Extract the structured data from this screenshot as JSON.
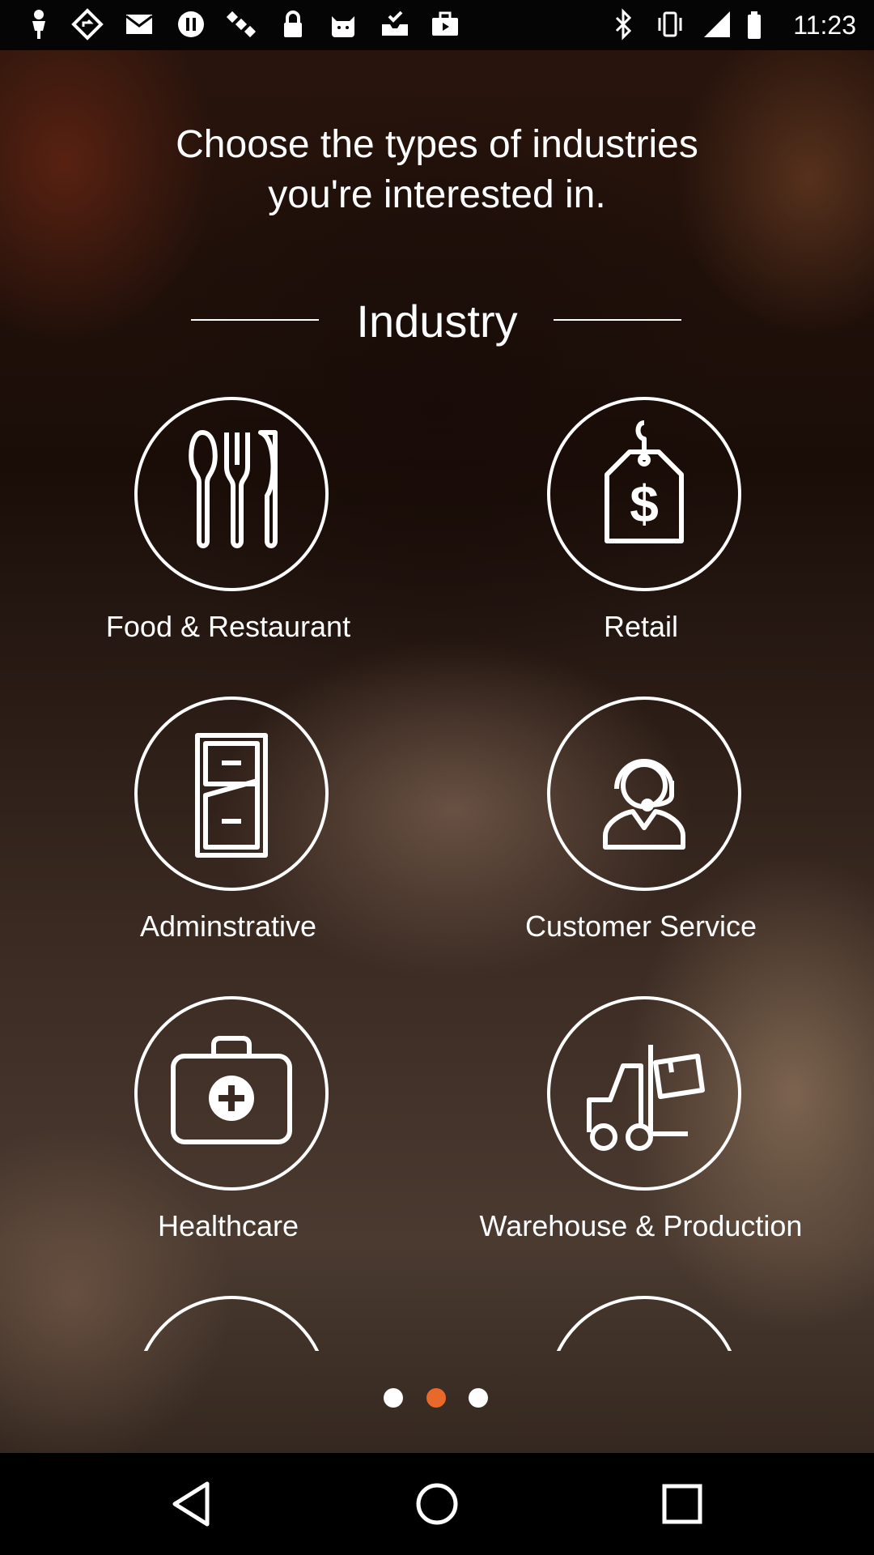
{
  "status_bar": {
    "time": "11:23",
    "icons": [
      "person-icon",
      "navigation-icon",
      "mail-icon",
      "pause-circle-icon",
      "satellite-icon",
      "lock-icon",
      "cat-icon",
      "tray-check-icon",
      "briefcase-icon",
      "bluetooth-icon",
      "vibrate-icon",
      "signal-icon",
      "battery-icon"
    ]
  },
  "heading": {
    "line1": "Choose the types of industries",
    "line2": "you're interested in."
  },
  "section": {
    "title": "Industry"
  },
  "industries": [
    {
      "label": "Food & Restaurant",
      "icon": "utensils-icon"
    },
    {
      "label": "Retail",
      "icon": "price-tag-icon"
    },
    {
      "label": "Adminstrative",
      "icon": "file-cabinet-icon"
    },
    {
      "label": "Customer Service",
      "icon": "headset-agent-icon"
    },
    {
      "label": "Healthcare",
      "icon": "medical-kit-icon"
    },
    {
      "label": "Warehouse & Production",
      "icon": "forklift-icon"
    }
  ],
  "pager": {
    "count": 3,
    "active_index": 1,
    "active_color": "#e8692a",
    "inactive_color": "#ffffff"
  },
  "nav_bar": {
    "buttons": [
      "back-icon",
      "home-icon",
      "recents-icon"
    ]
  }
}
